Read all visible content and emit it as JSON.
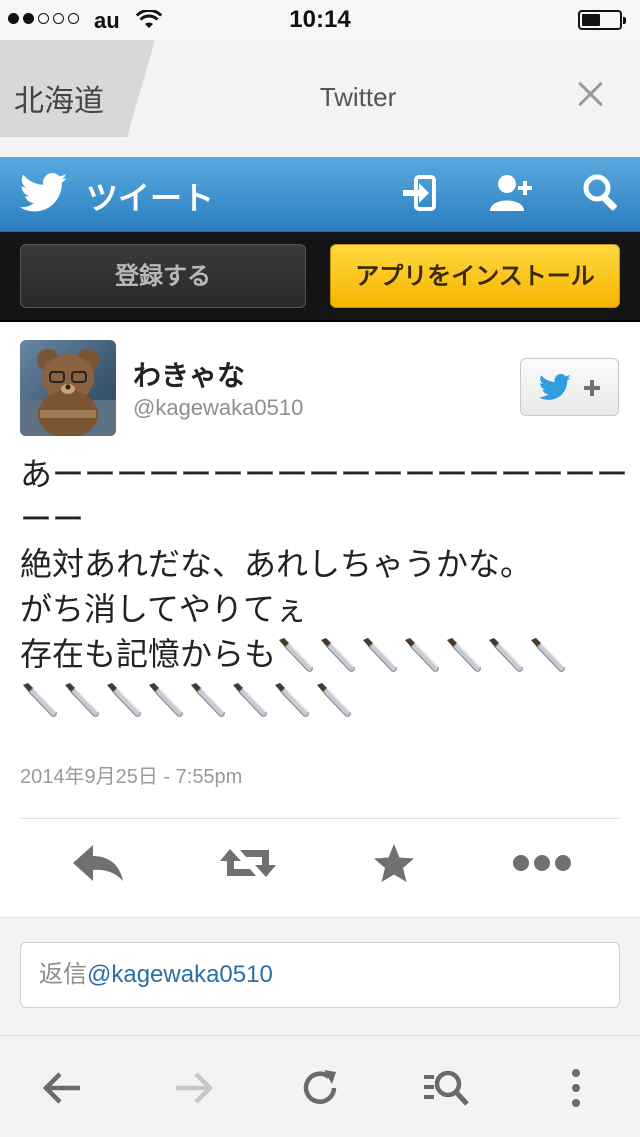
{
  "status_bar": {
    "carrier": "au",
    "time": "10:14",
    "signal_bars_filled": 2,
    "signal_bars_total": 5
  },
  "browser": {
    "tabs": [
      {
        "title": "北海道 ",
        "active": false
      },
      {
        "title": "Twitter",
        "active": true
      }
    ],
    "close_icon": "close-icon"
  },
  "twitter_header": {
    "title": "ツイート",
    "icons": [
      "login-icon",
      "add-user-icon",
      "search-icon"
    ],
    "brand_color": "#3a8fd0"
  },
  "action_bar": {
    "register_label": "登録する",
    "install_label": "アプリをインストール",
    "install_color": "#f8c400"
  },
  "tweet": {
    "author_name": "わきゃな",
    "author_handle": "@kagewaka0510",
    "follow_icon": "twitter-follow-icon",
    "text_lines": [
      "あーーーーーーーーーーーーーーーーーー",
      "ーー",
      "絶対あれだな、あれしちゃうかな。",
      "がち消してやりてぇ",
      "存在も記憶からも"
    ],
    "knife_emoji_count_line5": 7,
    "knife_emoji_count_line6": 8,
    "timestamp": "2014年9月25日 - 7:55pm",
    "actions": [
      "reply-icon",
      "retweet-icon",
      "favorite-icon",
      "more-icon"
    ]
  },
  "reply": {
    "prefix": "返信",
    "handle": "@kagewaka0510"
  },
  "toolbar": {
    "icons": [
      "back-icon",
      "forward-icon",
      "reload-icon",
      "find-in-page-icon",
      "menu-icon"
    ]
  }
}
